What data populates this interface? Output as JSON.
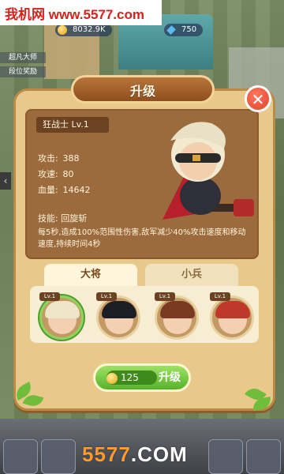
{
  "watermark": "我机网 www.5577.com",
  "resources": {
    "gold": "8032.9K",
    "gems": "750"
  },
  "side_labels": [
    "超凡大师",
    "段位奖励"
  ],
  "dialog": {
    "title": "升级",
    "close": "✕",
    "hero": {
      "name_level": "狂战士 Lv.1",
      "stats": [
        {
          "label": "攻击:",
          "value": "388"
        },
        {
          "label": "攻速:",
          "value": "80"
        },
        {
          "label": "血量:",
          "value": "14642"
        }
      ],
      "skill_title": "技能: 回旋斩",
      "skill_desc": "每5秒,造成100%范围性伤害,敌军减少40%攻击速度和移动速度,持续时间4秒"
    },
    "tabs": [
      {
        "label": "大将",
        "active": true
      },
      {
        "label": "小兵",
        "active": false
      }
    ],
    "units": [
      {
        "level": "Lv.1",
        "hair": "#efe6c9",
        "selected": true
      },
      {
        "level": "Lv.1",
        "hair": "#1d1d24",
        "selected": false
      },
      {
        "level": "Lv.1",
        "hair": "#7a3a22",
        "selected": false
      },
      {
        "level": "Lv.1",
        "hair": "#c0382a",
        "selected": false
      }
    ],
    "upgrade": {
      "cost": "125",
      "label": "升级"
    }
  },
  "footer": {
    "brand_main": "5577",
    "brand_suffix": ".COM"
  },
  "colors": {
    "panel": "#e8c98b",
    "detail": "#9b6b3e",
    "button": "#56b22c",
    "close": "#e0402c"
  }
}
